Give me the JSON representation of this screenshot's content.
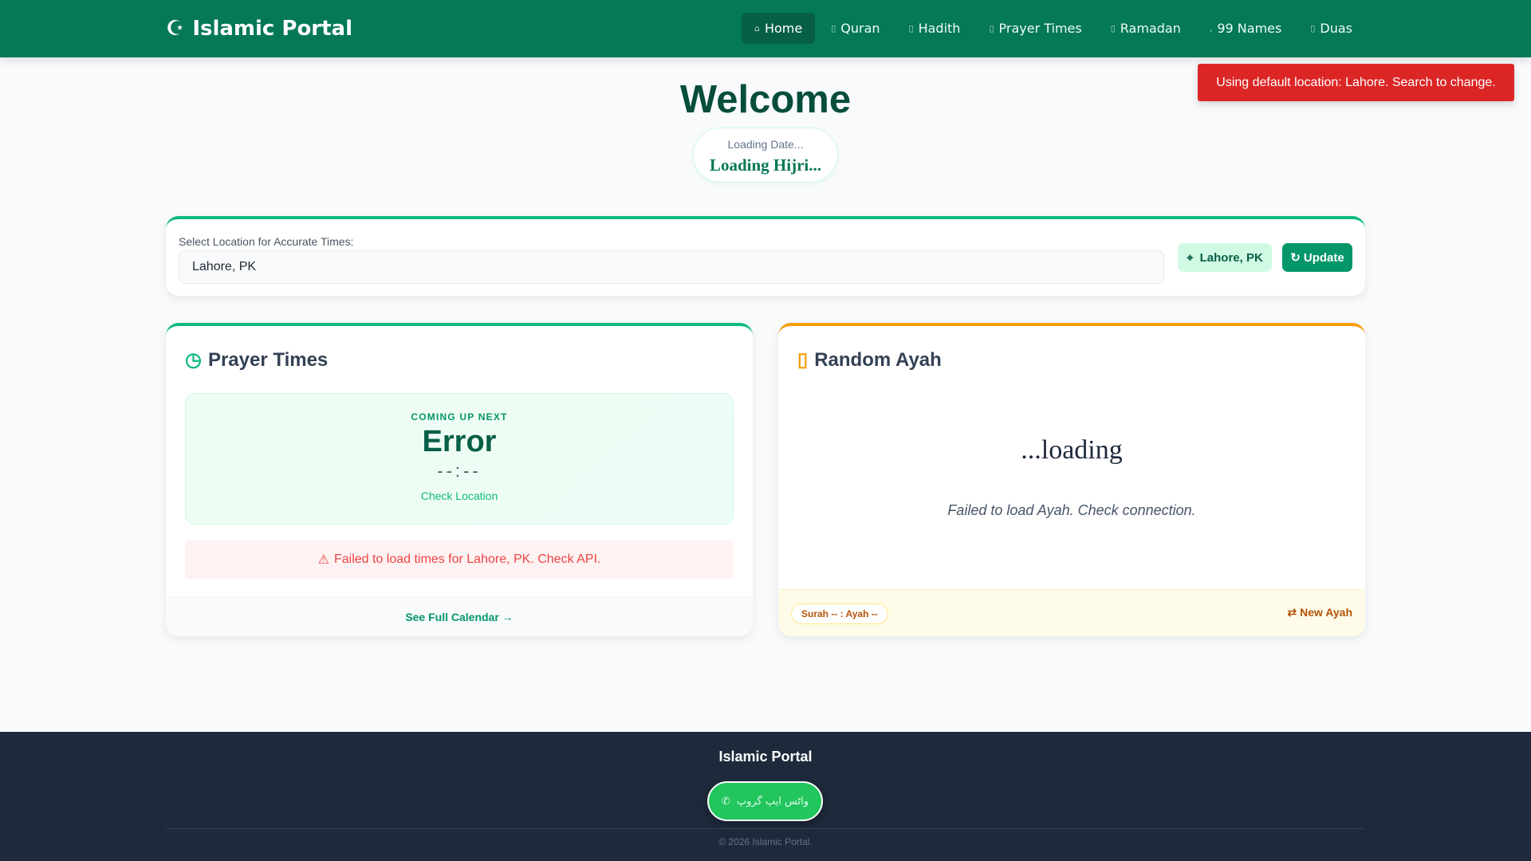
{
  "nav": {
    "brand": "Islamic Portal",
    "brand_icon": "mosque-icon",
    "items": [
      {
        "label": "Home",
        "icon": "home-icon",
        "active": true
      },
      {
        "label": "Quran",
        "icon": "book-icon"
      },
      {
        "label": "Hadith",
        "icon": "scroll-icon"
      },
      {
        "label": "Prayer Times",
        "icon": "clock-icon"
      },
      {
        "label": "Ramadan",
        "icon": "moon-icon"
      },
      {
        "label": "99 Names",
        "icon": "star-icon"
      },
      {
        "label": "Duas",
        "icon": "hands-icon"
      }
    ]
  },
  "toast": "Using default location: Lahore. Search to change.",
  "hero": {
    "title": "Welcome",
    "date": "Loading Date...",
    "hijri": "Loading Hijri..."
  },
  "location": {
    "label": "Select Location for Accurate Times:",
    "value": "Lahore, PK",
    "current_button": "Lahore, PK",
    "update_button": "Update"
  },
  "prayer": {
    "title": "Prayer Times",
    "coming_up": "COMING UP NEXT",
    "next_name": "Error",
    "next_time": "--:--",
    "next_sub": "Check Location",
    "error": "Failed to load times for Lahore, PK. Check API.",
    "calendar_link": "See Full Calendar →"
  },
  "ayah": {
    "title": "Random Ayah",
    "arabic": "...loading",
    "translation": "Failed to load Ayah. Check connection.",
    "reference": "Surah -- : Ayah --",
    "new_button": "New Ayah"
  },
  "footer": {
    "title": "Islamic Portal",
    "whatsapp_label": "واٹس ایپ گروپ",
    "copyright": "© 2026 Islamic Portal."
  },
  "colors": {
    "primary": "#047857",
    "accent": "#10b981",
    "amber": "#f59e0b",
    "danger": "#dc2626",
    "footer": "#1e293b"
  }
}
